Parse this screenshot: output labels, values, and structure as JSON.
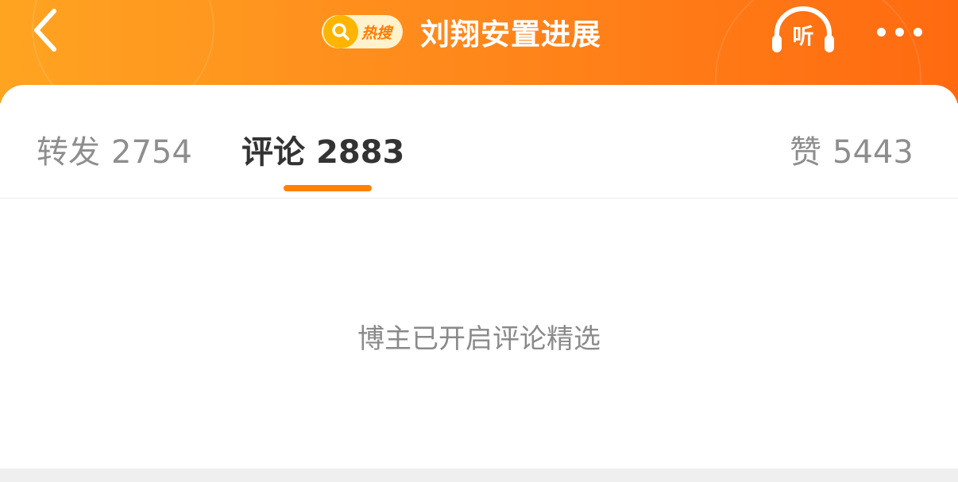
{
  "header": {
    "back_icon": "chevron-left-icon",
    "hot_badge_label": "热搜",
    "hot_badge_icon": "search-icon",
    "title": "刘翔安置进展",
    "listen_label": "听",
    "listen_icon": "headphones-icon",
    "more_icon": "more-dots-icon"
  },
  "tabs": [
    {
      "label": "转发",
      "count": "2754",
      "active": false
    },
    {
      "label": "评论",
      "count": "2883",
      "active": true
    },
    {
      "label": "赞",
      "count": "5443",
      "active": false
    }
  ],
  "empty_message": "博主已开启评论精选",
  "colors": {
    "header_start": "#ffa421",
    "header_end": "#ff6a10",
    "accent": "#ff8200",
    "active_tab_text": "#333333",
    "inactive_tab_text": "#8e8e8e"
  }
}
